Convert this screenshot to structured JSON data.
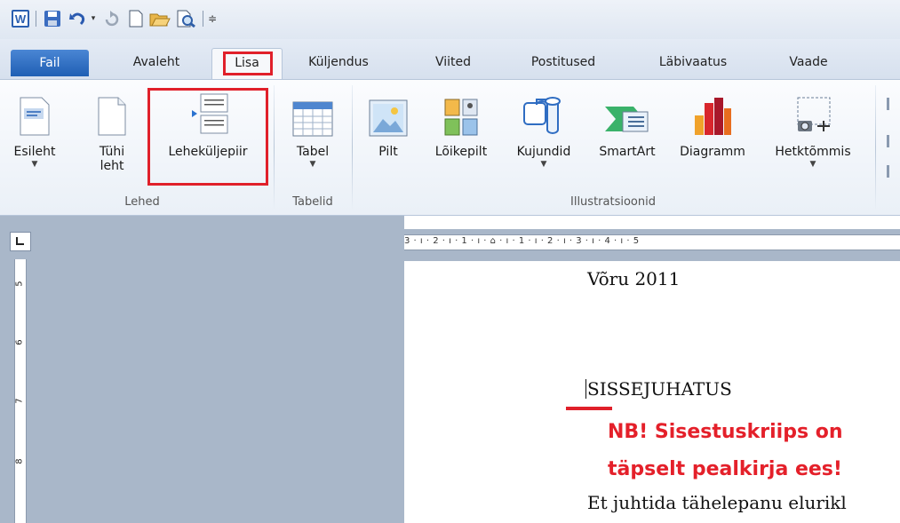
{
  "tabs": {
    "file": "Fail",
    "home": "Avaleht",
    "insert": "Lisa",
    "page_layout": "Küljendus",
    "references": "Viited",
    "mailings": "Postitused",
    "review": "Läbivaatus",
    "view": "Vaade"
  },
  "ribbon": {
    "pages_group": {
      "label": "Lehed",
      "cover_page": "Esileht",
      "blank_page_line1": "Tühi",
      "blank_page_line2": "leht",
      "page_break": "Leheküljepiir"
    },
    "tables_group": {
      "label": "Tabelid",
      "table": "Tabel"
    },
    "illustrations_group": {
      "label": "Illustratsioonid",
      "picture": "Pilt",
      "clip_art": "Lõikepilt",
      "shapes": "Kujundid",
      "smartart": "SmartArt",
      "chart": "Diagramm",
      "screenshot": "Hetktõmmis"
    }
  },
  "rulers": {
    "horizontal": "3 · ı · 2 · ı · 1 · ı · ⌂ · ı · 1 · ı · 2 · ı · 3 · ı · 4 · ı · 5",
    "vertical_marks": [
      "5",
      "6",
      "7",
      "8"
    ]
  },
  "document": {
    "line1": "Võru 2011",
    "heading": "SISSEJUHATUS",
    "note_line1": "NB! Sisestuskriips on",
    "note_line2": "täpselt pealkirja ees!",
    "body_start": "Et juhtida tähelepanu elurikl"
  },
  "colors": {
    "highlight_red": "#e0202a",
    "file_tab": "#2a67bb",
    "ribbon_bg": "#f3f6fa"
  }
}
